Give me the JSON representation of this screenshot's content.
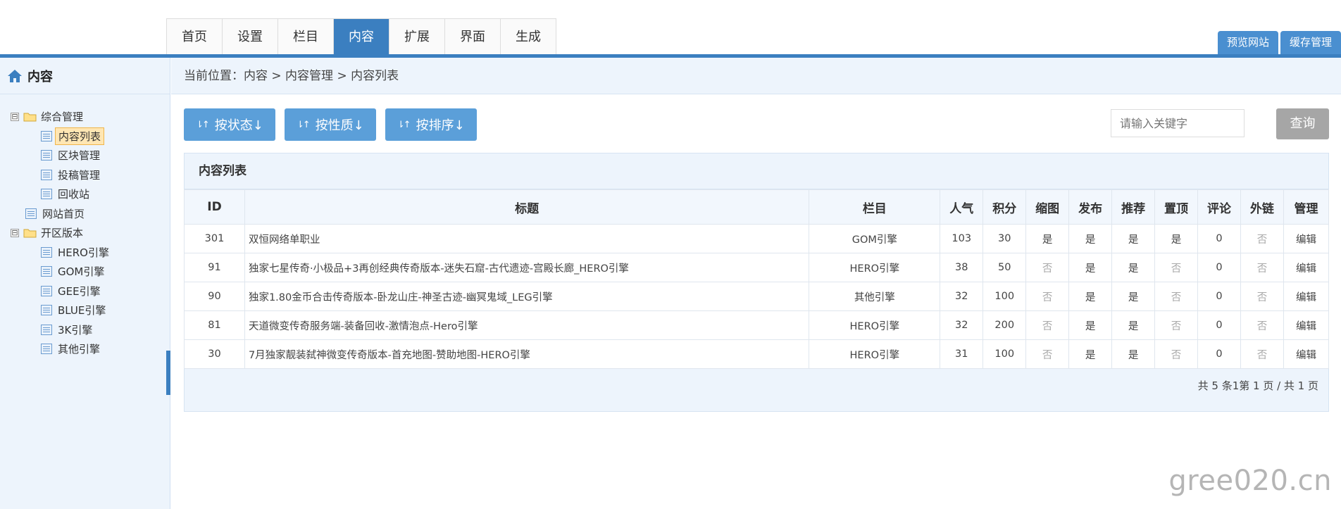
{
  "nav": {
    "tabs": [
      "首页",
      "设置",
      "栏目",
      "内容",
      "扩展",
      "界面",
      "生成"
    ],
    "active_index": 3,
    "right_buttons": [
      "预览网站",
      "缓存管理"
    ]
  },
  "sidebar": {
    "title": "内容",
    "tree": {
      "group1": {
        "label": "综合管理",
        "toggle": "⊟"
      },
      "group1_items": [
        "内容列表",
        "区块管理",
        "投稿管理",
        "回收站"
      ],
      "site_home": "网站首页",
      "group2": {
        "label": "开区版本",
        "toggle": "⊟"
      },
      "group2_items": [
        "HERO引擎",
        "GOM引擎",
        "GEE引擎",
        "BLUE引擎",
        "3K引擎",
        "其他引擎"
      ]
    }
  },
  "breadcrumb": "当前位置：内容 > 内容管理 > 内容列表",
  "toolbar": {
    "filter_buttons": [
      "按状态↓",
      "按性质↓",
      "按排序↓"
    ],
    "search_placeholder": "请输入关键字",
    "query_label": "查询"
  },
  "panel": {
    "title": "内容列表",
    "columns": [
      "ID",
      "标题",
      "栏目",
      "人气",
      "积分",
      "缩图",
      "发布",
      "推荐",
      "置顶",
      "评论",
      "外链",
      "管理"
    ],
    "rows": [
      [
        "301",
        "双恒网络单职业",
        "GOM引擎",
        "103",
        "30",
        "是",
        "是",
        "是",
        "是",
        "0",
        "否",
        "编辑"
      ],
      [
        "91",
        "独家七星传奇·小极品+3再创经典传奇版本-迷失石窟-古代遗迹-宫殿长廊_HERO引擎",
        "HERO引擎",
        "38",
        "50",
        "否",
        "是",
        "是",
        "否",
        "0",
        "否",
        "编辑"
      ],
      [
        "90",
        "独家1.80金币合击传奇版本-卧龙山庄-神圣古迹-幽冥鬼域_LEG引擎",
        "其他引擎",
        "32",
        "100",
        "否",
        "是",
        "是",
        "否",
        "0",
        "否",
        "编辑"
      ],
      [
        "81",
        "天道微变传奇服务端-装备回收-激情泡点-Hero引擎",
        "HERO引擎",
        "32",
        "200",
        "否",
        "是",
        "是",
        "否",
        "0",
        "否",
        "编辑"
      ],
      [
        "30",
        "7月独家靓装弑神微变传奇版本-首充地图-赞助地图-HERO引擎",
        "HERO引擎",
        "31",
        "100",
        "否",
        "是",
        "是",
        "否",
        "0",
        "否",
        "编辑"
      ]
    ],
    "pager": "共 5 条1第 1 页 / 共 1 页"
  },
  "watermark": "gree020.cn",
  "colors": {
    "primary": "#3b7fc0",
    "button": "#5b9fd9",
    "panel_bg": "#edf4fc"
  }
}
